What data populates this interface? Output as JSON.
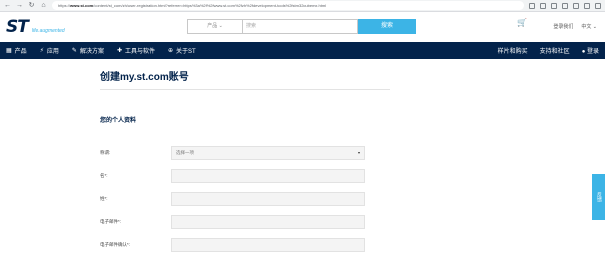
{
  "browser": {
    "url_prefix": "https://",
    "url_host": "www.st.com",
    "url_path": "/content/st_com/zh/user-registration.html?referrer=https%3a%2f%2fwww.st.com%2fzh%2fdevelopment-tools%2fstm32cubemx.html"
  },
  "brand": {
    "logo_text": "ST",
    "tagline": "life.augmented"
  },
  "search": {
    "category": "产品",
    "placeholder": "搜索",
    "button_label": "搜索"
  },
  "user": {
    "login_label": "登录我们",
    "language_label": "中文"
  },
  "nav": {
    "items": [
      "产品",
      "应用",
      "解决方案",
      "工具与软件",
      "关于ST"
    ],
    "right": [
      "样片和购买",
      "支持和社区",
      "登录"
    ]
  },
  "form": {
    "title": "创建my.st.com账号",
    "section": "您的个人资料",
    "fields": [
      {
        "label": "称谓:",
        "value": "选择一项"
      },
      {
        "label": "名*:",
        "value": ""
      },
      {
        "label": "姓*:",
        "value": ""
      },
      {
        "label": "电子邮件*:",
        "value": ""
      },
      {
        "label": "电子邮件确认*:",
        "value": ""
      }
    ]
  },
  "side_tab": "反馈"
}
